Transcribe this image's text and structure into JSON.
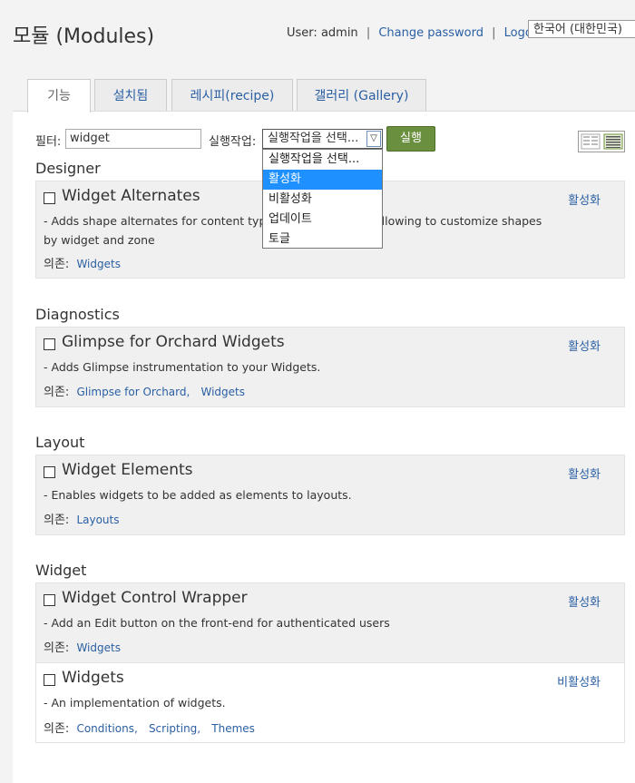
{
  "header": {
    "title": "모듈 (Modules)",
    "user_label": "User:",
    "user_name": "admin",
    "change_password": "Change password",
    "logout": "Logout",
    "separator": "|",
    "language": "한국어 (대한민국)"
  },
  "tabs": [
    {
      "label": "기능"
    },
    {
      "label": "설치됨"
    },
    {
      "label": "레시피(recipe)"
    },
    {
      "label": "갤러리 (Gallery)"
    }
  ],
  "toolbar": {
    "filter_label": "필터:",
    "filter_value": "widget",
    "action_label": "실행작업:",
    "action_selected": "실행작업을 선택...",
    "run_label": "실행",
    "dropdown_options": [
      "실행작업을 선택...",
      "활성화",
      "비활성화",
      "업데이트",
      "토글"
    ],
    "dropdown_highlighted_index": 1
  },
  "deps_label": "의존:",
  "categories": [
    {
      "name": "Designer",
      "modules": [
        {
          "name": "Widget Alternates",
          "description_line1": "- Adds shape alternates for content types",
          "description_line1_hidden_end": "ts, allowing to customize shapes",
          "description_line2": "by widget and zone",
          "action": "활성화",
          "dependencies": [
            "Widgets"
          ]
        }
      ]
    },
    {
      "name": "Diagnostics",
      "modules": [
        {
          "name": "Glimpse for Orchard Widgets",
          "description": "- Adds Glimpse instrumentation to your Widgets.",
          "action": "활성화",
          "dependencies": [
            "Glimpse for Orchard,",
            "Widgets"
          ]
        }
      ]
    },
    {
      "name": "Layout",
      "modules": [
        {
          "name": "Widget Elements",
          "description": "- Enables widgets to be added as elements to layouts.",
          "action": "활성화",
          "dependencies": [
            "Layouts"
          ]
        }
      ]
    },
    {
      "name": "Widget",
      "modules": [
        {
          "name": "Widget Control Wrapper",
          "description": "- Add an Edit button on the front-end for authenticated users",
          "action": "활성화",
          "dependencies": [
            "Widgets"
          ]
        },
        {
          "name": "Widgets",
          "description": "- An implementation of widgets.",
          "action": "비활성화",
          "dependencies": [
            "Conditions,",
            "Scripting,",
            "Themes"
          ]
        }
      ]
    }
  ],
  "colors": {
    "link": "#2a5fa3",
    "run_button": "#6a8f3e",
    "dropdown_highlight": "#1e90ff",
    "module_bg": "#f0f0f0"
  }
}
